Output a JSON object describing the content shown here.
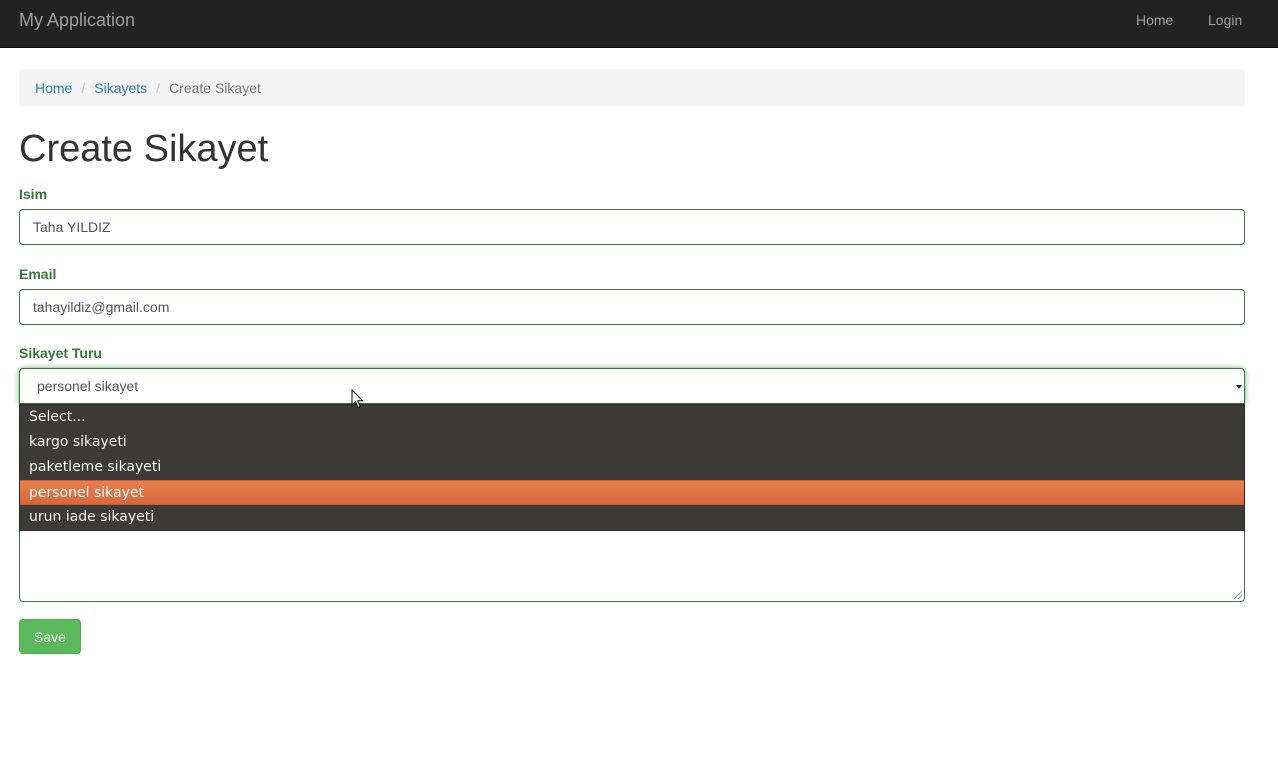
{
  "app": {
    "title": "My Application"
  },
  "navbar": {
    "home": "Home",
    "login": "Login"
  },
  "breadcrumb": {
    "home": "Home",
    "list": "Sikayets",
    "current": "Create Sikayet",
    "separator": "/"
  },
  "page": {
    "title": "Create Sikayet"
  },
  "form": {
    "isim": {
      "label": "Isim",
      "value": "Taha YILDIZ"
    },
    "email": {
      "label": "Email",
      "value": "tahayildiz@gmail.com"
    },
    "sikayet_turu": {
      "label": "Sikayet Turu",
      "selected": "personel sikayet",
      "options": [
        "Select...",
        "kargo sikayeti",
        "paketleme sikayeti",
        "personel sikayet",
        "urun iade sikayeti"
      ],
      "highlighted_index": 3
    },
    "save_label": "Save"
  },
  "colors": {
    "navbar_bg": "#222222",
    "link": "#337ab7",
    "success": "#5cb85c",
    "label_green": "#3c763d",
    "dropdown_bg": "#3c3b37",
    "dropdown_highlight": "#e07247"
  }
}
